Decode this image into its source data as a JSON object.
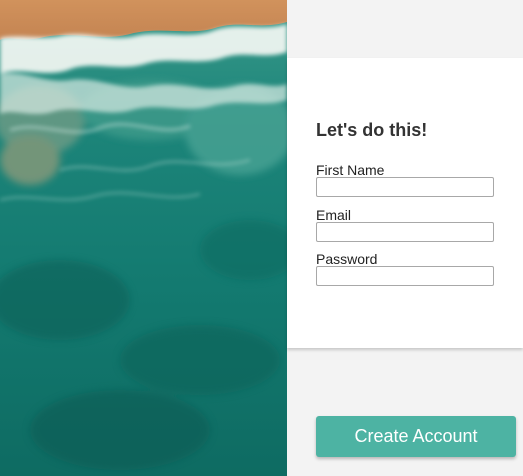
{
  "signup": {
    "title": "Let's do this!",
    "fields": [
      {
        "label": "First Name",
        "value": "",
        "placeholder": ""
      },
      {
        "label": "Email",
        "value": "",
        "placeholder": ""
      },
      {
        "label": "Password",
        "value": "",
        "placeholder": ""
      }
    ],
    "submit_label": "Create Account"
  },
  "colors": {
    "accent": "#4db3a3",
    "page_background": "#f3f3f3",
    "card_background": "#ffffff",
    "sea": "#13786f",
    "sand": "#c98a55"
  },
  "hero_image": {
    "icon": "aerial-beach-photo"
  }
}
